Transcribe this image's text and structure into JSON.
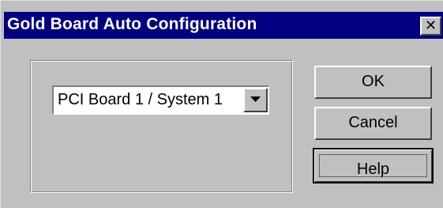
{
  "window": {
    "title": "Gold Board Auto Configuration",
    "close_glyph": "✕"
  },
  "board_select": {
    "selected": "PCI Board 1 / System 1"
  },
  "buttons": {
    "ok": "OK",
    "cancel": "Cancel",
    "help": "Help"
  },
  "icons": {
    "close": "close-icon",
    "dropdown": "chevron-down-icon"
  },
  "colors": {
    "titlebar": "#000080",
    "face": "#c0c0c0"
  }
}
